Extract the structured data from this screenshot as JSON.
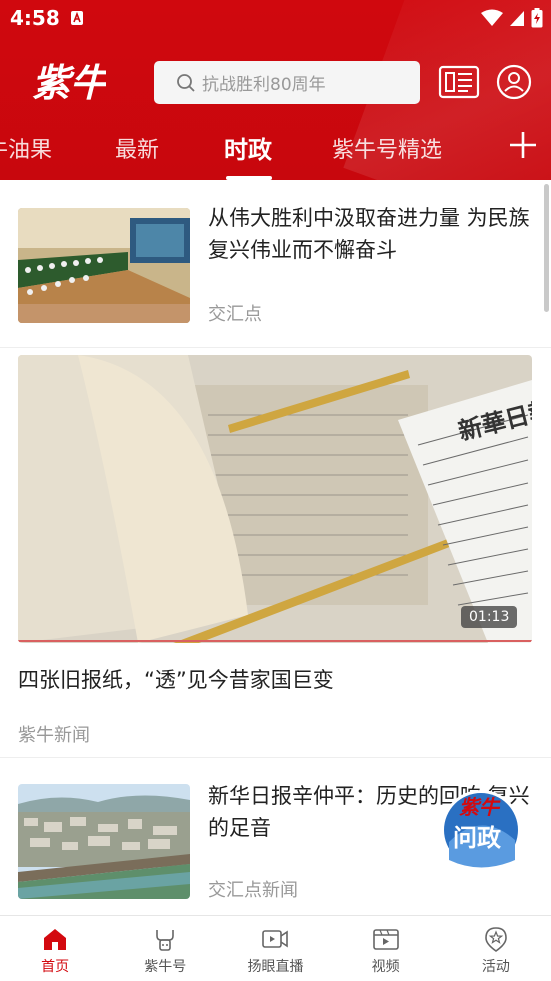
{
  "status": {
    "time": "4:58"
  },
  "header": {
    "logo_text": "紫牛",
    "search_placeholder": "抗战胜利80周年"
  },
  "tabs": [
    {
      "label": "牛油果",
      "visible_label": "牛油果"
    },
    {
      "label": "最新"
    },
    {
      "label": "时政",
      "active": true
    },
    {
      "label": "紫牛号精选"
    }
  ],
  "feed": [
    {
      "title": "从伟大胜利中汲取奋进力量 为民族复兴伟业而不懈奋斗",
      "source": "交汇点"
    },
    {
      "title": "四张旧报纸，“透”见今昔家国巨变",
      "source": "紫牛新闻",
      "duration": "01:13",
      "newspaper_masthead": "新華日報"
    },
    {
      "title": "新华日报辛仲平：历史的回响 复兴的足音",
      "source": "交汇点新闻"
    }
  ],
  "float_badge": {
    "line1": "紫牛",
    "line2": "问政"
  },
  "bottom_nav": [
    {
      "label": "首页",
      "icon": "home-icon",
      "active": true
    },
    {
      "label": "紫牛号",
      "icon": "ziniu-hao-icon"
    },
    {
      "label": "扬眼直播",
      "icon": "live-icon"
    },
    {
      "label": "视频",
      "icon": "video-icon"
    },
    {
      "label": "活动",
      "icon": "activity-icon"
    }
  ],
  "colors": {
    "brand_red": "#d0080e",
    "source_gray": "#999999"
  }
}
